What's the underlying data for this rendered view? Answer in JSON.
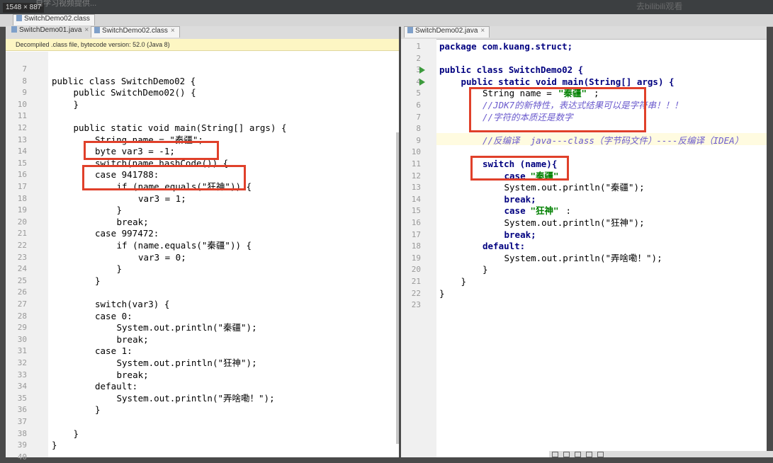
{
  "top": {
    "dimensions": "1548 × 887",
    "blurred_title": "自学习视频提供...",
    "blurred_right": "去bilibili观看",
    "file_tab": "SwitchDemo02.class"
  },
  "left": {
    "tabs": [
      {
        "label": "SwitchDemo01.java",
        "active": false
      },
      {
        "label": "SwitchDemo02.class",
        "active": true
      }
    ],
    "notice": "Decompiled .class file, bytecode version: 52.0 (Java 8)",
    "line_numbers": [
      "7",
      "8",
      "9",
      "10",
      "11",
      "12",
      "13",
      "14",
      "15",
      "16",
      "17",
      "18",
      "19",
      "20",
      "21",
      "22",
      "23",
      "24",
      "25",
      "26",
      "27",
      "28",
      "29",
      "30",
      "31",
      "32",
      "33",
      "34",
      "35",
      "36",
      "37",
      "38",
      "39",
      "40"
    ],
    "code": {
      "l8": "public class SwitchDemo02 {",
      "l9": "public SwitchDemo02() {",
      "l10": "}",
      "l12": "public static void main(String[] args) {",
      "l13": "String name = \"秦疆\";",
      "l14": "byte var3 = -1;",
      "l15": "switch(name.hashCode()) {",
      "l16": "case 941788:",
      "l17": "if (name.equals(\"狂神\")) {",
      "l18": "var3 = 1;",
      "l19": "}",
      "l20": "break;",
      "l21": "case 997472:",
      "l22": "if (name.equals(\"秦疆\")) {",
      "l23": "var3 = 0;",
      "l24": "}",
      "l25": "}",
      "l27": "switch(var3) {",
      "l28": "case 0:",
      "l29": "System.out.println(\"秦疆\");",
      "l30": "break;",
      "l31": "case 1:",
      "l32": "System.out.println(\"狂神\");",
      "l33": "break;",
      "l34": "default:",
      "l35": "System.out.println(\"弄啥嘞！\");",
      "l36": "}",
      "l38": "}",
      "l39": "}"
    }
  },
  "right": {
    "tabs": [
      {
        "label": "SwitchDemo02.java",
        "active": true
      }
    ],
    "line_numbers": [
      "1",
      "2",
      "3",
      "4",
      "5",
      "6",
      "7",
      "8",
      "9",
      "10",
      "11",
      "12",
      "13",
      "14",
      "15",
      "16",
      "17",
      "18",
      "19",
      "20",
      "21",
      "22",
      "23"
    ],
    "code": {
      "l1": "package com.kuang.struct;",
      "l3": "public class SwitchDemo02 {",
      "l4": "public static void main(String[] args) {",
      "l5a": "String name = ",
      "l5b": "\"秦疆\"",
      "l5c": ";",
      "l6": "//JDK7的新特性，表达式结果可以是字符串！！！",
      "l7": "//字符的本质还是数字",
      "l9": "//反编译  java---class（字节码文件）----反编译（IDEA）",
      "l11": "switch (name){",
      "l12a": "case ",
      "l12b": "\"秦疆\"",
      "l12c": ":",
      "l13": "System.out.println(\"秦疆\");",
      "l14": "break;",
      "l15a": "case ",
      "l15b": "\"狂神\"",
      "l15c": ":",
      "l16": "System.out.println(\"狂神\");",
      "l17": "break;",
      "l18": "default:",
      "l19": "System.out.println(\"弄啥嘞！\");",
      "l20": "}",
      "l21": "}",
      "l22": "}"
    }
  },
  "colors": {
    "keyword": "#000080",
    "string": "#008000",
    "comment": "#6a5acd",
    "annotation_box": "#e0402a",
    "notice_bg": "#fdf6c3"
  }
}
